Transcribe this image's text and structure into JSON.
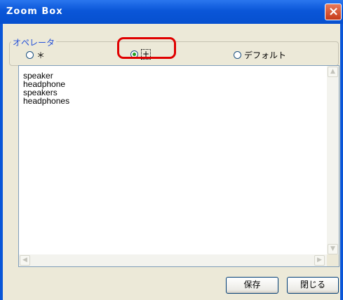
{
  "window": {
    "title": "Zoom Box",
    "close_icon": "×"
  },
  "operator_group": {
    "legend": "オペレータ",
    "options": [
      {
        "label": "＊",
        "selected": false
      },
      {
        "label": "+",
        "selected": true
      },
      {
        "label": "デフォルト",
        "selected": false
      }
    ]
  },
  "list": {
    "items": [
      "speaker",
      "headphone",
      "speakers",
      "headphones"
    ]
  },
  "scrollbar": {
    "up": "▲",
    "down": "▼",
    "left": "◀",
    "right": "▶"
  },
  "buttons": {
    "save": "保存",
    "close": "閉じる"
  },
  "colors": {
    "titlebar": "#0a56d8",
    "accent_legend": "#2450d8",
    "selected_dot": "#21a121",
    "highlight": "#e00000"
  }
}
